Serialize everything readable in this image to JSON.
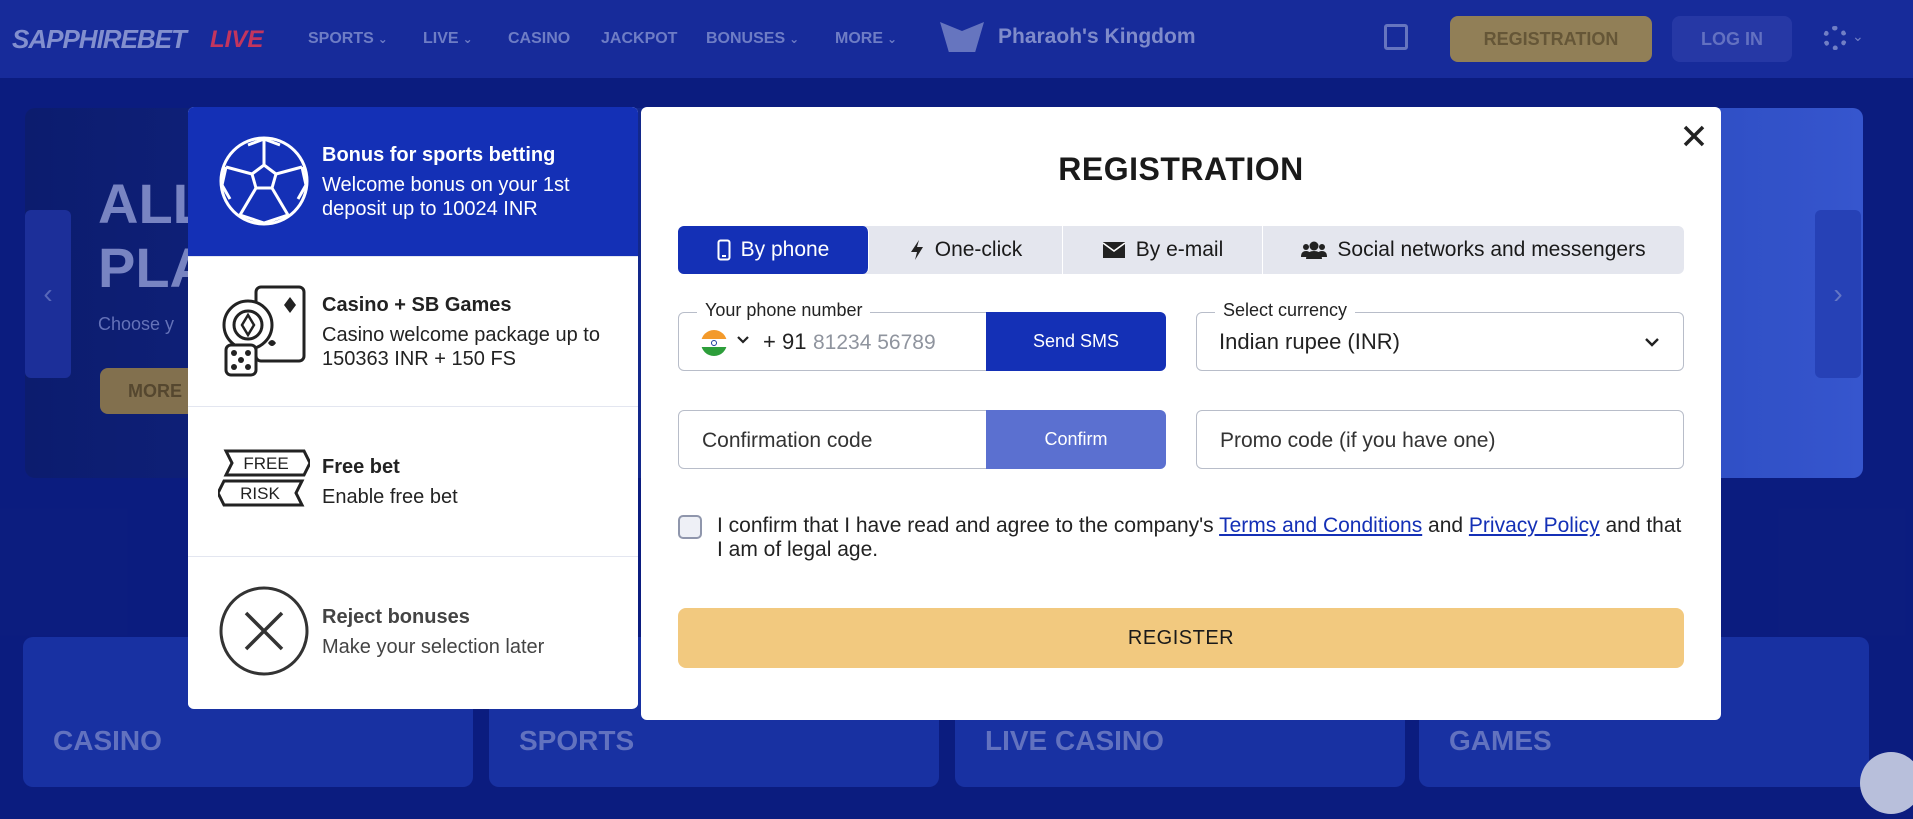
{
  "site": {
    "logo": "SAPPHIREBET",
    "logo_secondary": "LIVE",
    "nav": [
      {
        "label": "SPORTS",
        "chevron": true
      },
      {
        "label": "LIVE",
        "chevron": true
      },
      {
        "label": "CASINO",
        "chevron": false
      },
      {
        "label": "JACKPOT",
        "chevron": false
      },
      {
        "label": "BONUSES",
        "chevron": true
      },
      {
        "label": "MORE",
        "chevron": true
      }
    ],
    "promo_link": "Pharaoh's Kingdom",
    "registration_button": "REGISTRATION",
    "login_button": "LOG IN",
    "hero": {
      "title_line1": "ALL",
      "title_line2": "PLA",
      "subtitle": "Choose y",
      "button": "MORE"
    },
    "categories": [
      "CASINO",
      "SPORTS",
      "LIVE CASINO",
      "GAMES"
    ]
  },
  "bonuses": [
    {
      "id": "sports",
      "icon": "soccer-ball-icon",
      "title": "Bonus for sports betting",
      "description": "Welcome bonus on your 1st deposit up to 10024 INR",
      "selected": true
    },
    {
      "id": "casino",
      "icon": "casino-chips-cards-icon",
      "title": "Casino + SB Games",
      "description": "Casino welcome package up to 150363 INR + 150 FS",
      "selected": false
    },
    {
      "id": "freebet",
      "icon": "free-risk-ticket-icon",
      "icon_text_top": "FREE",
      "icon_text_bottom": "RISK",
      "title": "Free bet",
      "description": "Enable free bet",
      "selected": false
    },
    {
      "id": "reject",
      "icon": "x-circle-icon",
      "title": "Reject bonuses",
      "description": "Make your selection later",
      "selected": false
    }
  ],
  "registration": {
    "title": "REGISTRATION",
    "tabs": [
      {
        "label": "By phone",
        "icon": "phone-icon",
        "active": true
      },
      {
        "label": "One-click",
        "icon": "lightning-icon",
        "active": false
      },
      {
        "label": "By e-mail",
        "icon": "envelope-icon",
        "active": false
      },
      {
        "label": "Social networks and messengers",
        "icon": "users-icon",
        "active": false
      }
    ],
    "phone": {
      "legend": "Your phone number",
      "country_flag": "india-flag-icon",
      "dial_code": "+ 91",
      "placeholder": "81234 56789",
      "send_button": "Send SMS"
    },
    "currency": {
      "legend": "Select currency",
      "value": "Indian rupee (INR)"
    },
    "confirmation": {
      "placeholder": "Confirmation code",
      "button": "Confirm"
    },
    "promo": {
      "placeholder": "Promo code (if you have one)"
    },
    "consent": {
      "checked": false,
      "text_before": "I confirm that I have read and agree to the company's ",
      "terms_link": "Terms and Conditions",
      "text_middle": " and ",
      "privacy_link": "Privacy Policy",
      "text_after": " and that I am of legal age."
    },
    "submit_button": "REGISTER"
  },
  "colors": {
    "primary": "#1430b6",
    "confirm_button": "#5b70d0",
    "register_button": "#f2c97f",
    "tabs_bg": "#e4e6ee",
    "page_bg": "#0d1f8a"
  }
}
